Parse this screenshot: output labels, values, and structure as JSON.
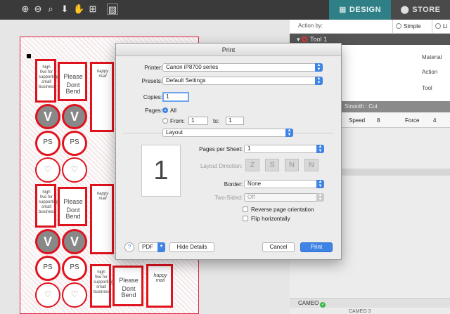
{
  "top_bar": {
    "design_tab": "DESIGN",
    "store_tab": "STORE",
    "tool_icons": [
      "zoom-in-icon",
      "zoom-out-icon",
      "zoom-selection-icon",
      "move-down-icon",
      "pan-hand-icon",
      "fit-page-icon",
      "texture-icon"
    ]
  },
  "right_panel": {
    "action_by_label": "Action by:",
    "simple_label": "Simple",
    "line_label": "Li",
    "tool_header": "Tool 1",
    "material_label": "Material",
    "action_label": "Action",
    "tool_label": "Tool",
    "smooth_bar": "Smooth : Cut",
    "speed_label": "Speed",
    "speed_value": "8",
    "force_label": "Force",
    "force_value": "4",
    "cameo_label": "CAMEO",
    "cameo_sub": "CAMEO 3"
  },
  "stickers": {
    "please": "Please",
    "dont_bend": "Dont Bend",
    "ps": "PS",
    "v": "V",
    "happy_mail": "happy mail",
    "high_five": "high five for supporting small business"
  },
  "print_dialog": {
    "title": "Print",
    "printer_label": "Printer:",
    "printer_value": "Canon iP8700 series",
    "presets_label": "Presets:",
    "presets_value": "Default Settings",
    "copies_label": "Copies:",
    "copies_value": "1",
    "pages_label": "Pages:",
    "pages_all": "All",
    "pages_from": "From:",
    "from_value": "1",
    "pages_to": "to:",
    "to_value": "1",
    "section_value": "Layout",
    "preview_page": "1",
    "pages_per_sheet_label": "Pages per Sheet:",
    "pages_per_sheet_value": "1",
    "layout_direction_label": "Layout Direction:",
    "border_label": "Border:",
    "border_value": "None",
    "two_sided_label": "Two-Sided:",
    "two_sided_value": "Off",
    "reverse_orientation": "Reverse page orientation",
    "flip_horizontally": "Flip horizontally",
    "help": "?",
    "pdf": "PDF",
    "hide_details": "Hide Details",
    "cancel": "Cancel",
    "print": "Print"
  }
}
